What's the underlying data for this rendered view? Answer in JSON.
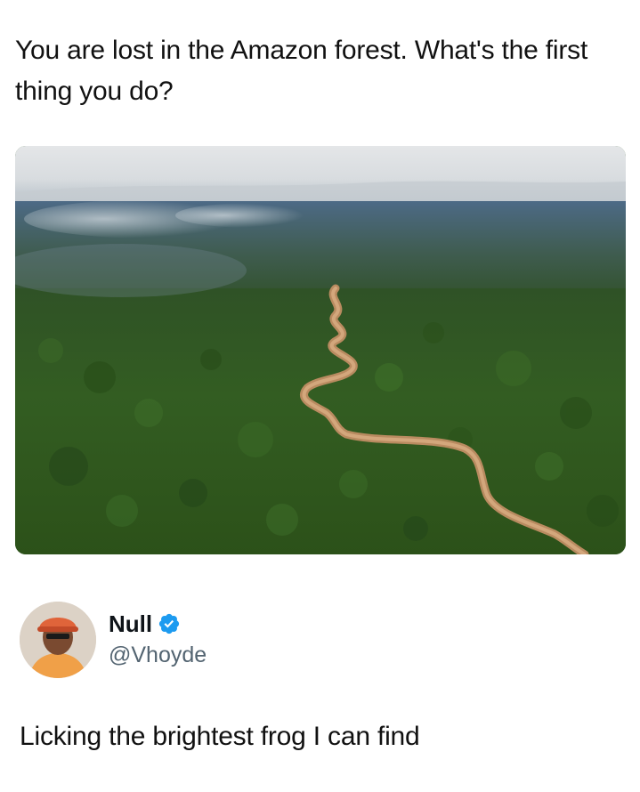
{
  "post": {
    "text": "You are lost in the Amazon forest. What's the first thing you do?",
    "media": {
      "icon": "aerial-rainforest-river-photo"
    }
  },
  "reply": {
    "author": {
      "display_name": "Null",
      "handle": "@Vhoyde",
      "verified": true,
      "verified_color": "#1d9bf0",
      "avatar_icon": "person-with-cap-avatar"
    },
    "text": "Licking the brightest frog I can find"
  }
}
